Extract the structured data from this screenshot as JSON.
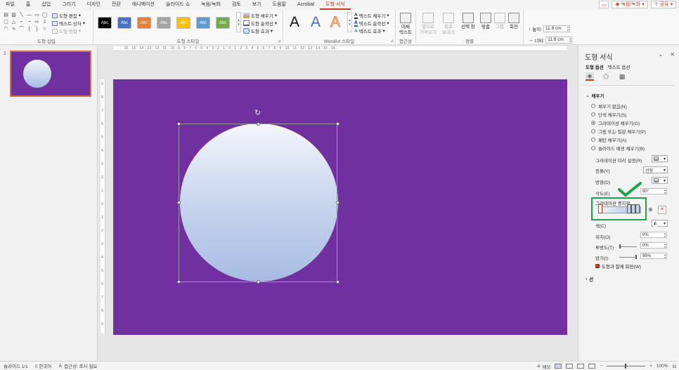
{
  "tabs": [
    "파일",
    "홈",
    "삽입",
    "그리기",
    "디자인",
    "전환",
    "애니메이션",
    "슬라이드 쇼",
    "녹음/녹화",
    "검토",
    "보기",
    "도움말",
    "Acrobat",
    "도형 서식"
  ],
  "active_tab": "도형 서식",
  "titlebar": {
    "record_label": "녹음/녹화",
    "share_label": "공유"
  },
  "ribbon": {
    "insert_shapes": {
      "label": "도형 삽입",
      "edit_shape": "도형 편집",
      "text_box": "텍스트 상자",
      "merge_shapes": "도형 병합"
    },
    "shape_styles": {
      "label": "도형 스타일",
      "swatch_text": "Abc",
      "swatch_colors": [
        "#000000",
        "#4472c4",
        "#ed7d31",
        "#a5a5a5",
        "#ffc000",
        "#5b9bd5",
        "#70ad47"
      ],
      "fill": "도형 채우기",
      "outline": "도형 윤곽선",
      "effects": "도형 효과"
    },
    "wordart": {
      "label": "WordArt 스타일",
      "letter": "A",
      "text_fill": "텍스트 채우기",
      "text_outline": "텍스트 윤곽선",
      "text_effects": "텍스트 효과"
    },
    "accessibility": {
      "label": "접근성",
      "alt_text_1": "대체",
      "alt_text_2": "텍스트"
    },
    "arrange": {
      "label": "정렬",
      "bring_forward_1": "앞으로",
      "bring_forward_2": "가져오기",
      "send_backward_1": "뒤로",
      "send_backward_2": "보내기",
      "selection_pane": "선택 창",
      "align": "맞춤",
      "group": "그룹",
      "rotate": "회전"
    },
    "size": {
      "label": "크기",
      "height_label": "높이:",
      "height_value": "11.8 cm",
      "width_label": "너비:",
      "width_value": "11.8 cm"
    }
  },
  "thumbnail": {
    "number": "1"
  },
  "ruler": {
    "h_text": "· 16 · 15 · 14 · 13 · 12 · 11 · 10 · 9 · 8 · 7 · 6 · 5 · 4 · 3 · 2 · 1 · 0 · 1 · 2 · 3 · 4 · 5 · 6 · 7 · 8 · 9 · 10 · 11 · 12 · 13 · 14 · 15 · 16 ·",
    "v_ticks": [
      "9",
      "8",
      "7",
      "6",
      "5",
      "4",
      "3",
      "2",
      "1",
      "0",
      "1",
      "2",
      "3",
      "4",
      "5",
      "6",
      "7",
      "8",
      "9"
    ]
  },
  "pane": {
    "title": "도형 서식",
    "tab_shape_options": "도형 옵션",
    "tab_text_options": "텍스트 옵션",
    "fill_section": "채우기",
    "fill_options": [
      {
        "label": "채우기 없음(N)",
        "selected": false
      },
      {
        "label": "단색 채우기(S)",
        "selected": false
      },
      {
        "label": "그라데이션 채우기(G)",
        "selected": true
      },
      {
        "label": "그림 또는 질감 채우기(P)",
        "selected": false
      },
      {
        "label": "패턴 채우기(A)",
        "selected": false
      },
      {
        "label": "슬라이드 배경 채우기(B)",
        "selected": false
      }
    ],
    "preset_label": "그라데이션 미리 설정(R)",
    "type_label": "종류(Y)",
    "type_value": "선형",
    "direction_label": "방향(D)",
    "angle_label": "각도(E)",
    "angle_value": "90°",
    "stops_label": "그라데이션 중지점",
    "color_label": "색(C)",
    "position_label": "위치(O)",
    "position_value": "0%",
    "transparency_label": "투명도(T)",
    "transparency_value": "0%",
    "brightness_label": "밝기(I)",
    "brightness_value": "95%",
    "rotate_with_shape": "도형과 함께 회전(W)",
    "line_section": "선"
  },
  "statusbar": {
    "slide_info": "슬라이드 1/1",
    "language": "한국어",
    "accessibility": "접근성: 조사 필요",
    "notes": "메모",
    "zoom": "100%"
  },
  "colors": {
    "accent": "#c43e1c",
    "slide_bg": "#7030a0",
    "annotation_green": "#1fa34a"
  }
}
